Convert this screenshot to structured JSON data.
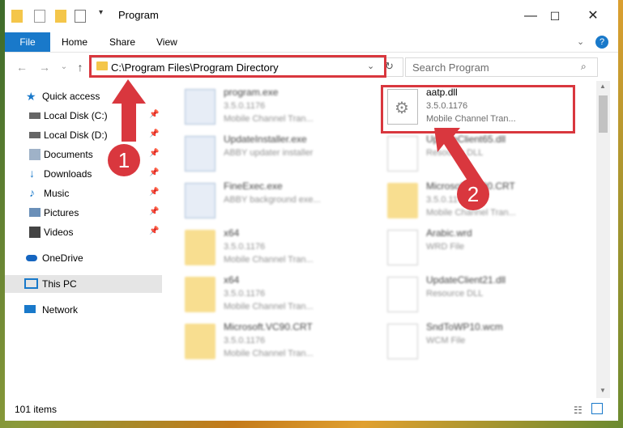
{
  "window": {
    "title": "Program",
    "min": "—",
    "max": "☐",
    "close": "✕"
  },
  "ribbon": {
    "tabs": [
      "File",
      "Home",
      "Share",
      "View"
    ]
  },
  "address": {
    "path": "C:\\Program Files\\Program Directory",
    "search_placeholder": "Search Program"
  },
  "sidebar": {
    "items": [
      {
        "label": "Quick access",
        "icon": "star-icon",
        "color": "#1979ca"
      },
      {
        "label": "Local Disk (C:)",
        "icon": "drive-icon",
        "color": "#666666"
      },
      {
        "label": "Local Disk (D:)",
        "icon": "drive-icon",
        "color": "#666666"
      },
      {
        "label": "Documents",
        "icon": "documents-icon",
        "color": "#7b8fa8"
      },
      {
        "label": "Downloads",
        "icon": "download-icon",
        "color": "#1979ca"
      },
      {
        "label": "Music",
        "icon": "music-icon",
        "color": "#1979ca"
      },
      {
        "label": "Pictures",
        "icon": "pictures-icon",
        "color": "#6a8fb8"
      },
      {
        "label": "Videos",
        "icon": "videos-icon",
        "color": "#444444"
      },
      {
        "label": "OneDrive",
        "icon": "cloud-icon",
        "color": "#1565c0"
      },
      {
        "label": "This PC",
        "icon": "pc-icon",
        "color": "#1979ca"
      },
      {
        "label": "Network",
        "icon": "network-icon",
        "color": "#1979ca"
      }
    ]
  },
  "files": [
    {
      "name": "program.exe",
      "l2": "3.5.0.1176",
      "l3": "Mobile Channel Tran...",
      "kind": "exe"
    },
    {
      "name": "aatp.dll",
      "l2": "3.5.0.1176",
      "l3": "Mobile Channel Tran...",
      "kind": "dll"
    },
    {
      "name": "UpdateInstaller.exe",
      "l2": "ABBY updater installer",
      "l3": "",
      "kind": "exe"
    },
    {
      "name": "UpdateClient65.dll",
      "l2": "Resource DLL",
      "l3": "",
      "kind": "dll"
    },
    {
      "name": "FineExec.exe",
      "l2": "ABBY background exe...",
      "l3": "",
      "kind": "exe"
    },
    {
      "name": "Microsoft.VC90.CRT",
      "l2": "3.5.0.1176",
      "l3": "Mobile Channel Tran...",
      "kind": "folder"
    },
    {
      "name": "x64",
      "l2": "3.5.0.1176",
      "l3": "Mobile Channel Tran...",
      "kind": "folder"
    },
    {
      "name": "Arabic.wrd",
      "l2": "WRD File",
      "l3": "",
      "kind": "doc"
    },
    {
      "name": "x64",
      "l2": "3.5.0.1176",
      "l3": "Mobile Channel Tran...",
      "kind": "folder"
    },
    {
      "name": "UpdateClient21.dll",
      "l2": "Resource DLL",
      "l3": "",
      "kind": "dll"
    },
    {
      "name": "Microsoft.VC90.CRT",
      "l2": "3.5.0.1176",
      "l3": "Mobile Channel Tran...",
      "kind": "folder"
    },
    {
      "name": "SndToWP10.wcm",
      "l2": "WCM File",
      "l3": "",
      "kind": "doc"
    }
  ],
  "status": {
    "count": "101 items"
  },
  "markers": {
    "one": "1",
    "two": "2"
  },
  "colors": {
    "accent": "#1979ca",
    "highlight": "#d9373e"
  }
}
